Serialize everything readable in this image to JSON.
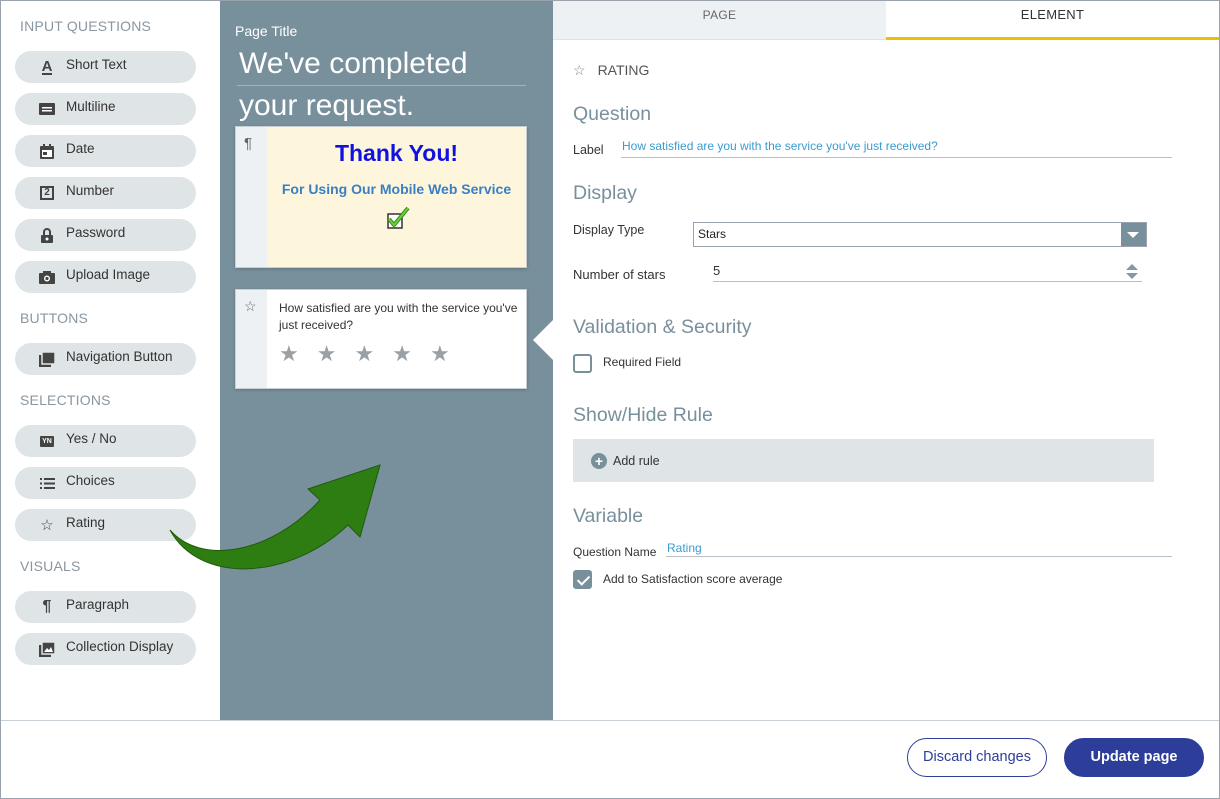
{
  "palette": {
    "sections": {
      "input_questions": "INPUT QUESTIONS",
      "buttons": "BUTTONS",
      "selections": "SELECTIONS",
      "visuals": "VISUALS"
    },
    "items": {
      "short_text": "Short Text",
      "multiline": "Multiline",
      "date": "Date",
      "number": "Number",
      "password": "Password",
      "upload_image": "Upload Image",
      "navigation_button": "Navigation Button",
      "yes_no": "Yes / No",
      "choices": "Choices",
      "rating": "Rating",
      "paragraph": "Paragraph",
      "collection_display": "Collection Display"
    },
    "icons": {
      "short_text": "A",
      "number": "2",
      "yes_no": "YN",
      "rating": "☆",
      "paragraph": "¶"
    }
  },
  "canvas": {
    "page_title_label": "Page Title",
    "page_title_line1": "We've completed",
    "page_title_line2": "your request.",
    "paragraph_card": {
      "icon": "¶",
      "heading": "Thank You!",
      "subheading": "For Using Our Mobile Web Service"
    },
    "rating_card": {
      "icon": "☆",
      "question": "How satisfied are you with the service you've just received?",
      "star_count": 5
    }
  },
  "props": {
    "tabs": {
      "page": "PAGE",
      "element": "ELEMENT"
    },
    "element_type": "RATING",
    "element_icon": "☆",
    "question": {
      "heading": "Question",
      "label_label": "Label",
      "label_value": "How satisfied are you with the service you've just received?"
    },
    "display": {
      "heading": "Display",
      "type_label": "Display Type",
      "type_value": "Stars",
      "stars_label": "Number of stars",
      "stars_value": "5"
    },
    "validation": {
      "heading": "Validation & Security",
      "required_label": "Required Field",
      "required_checked": false
    },
    "rules": {
      "heading": "Show/Hide Rule",
      "add_rule": "Add rule",
      "add_icon": "+"
    },
    "variable": {
      "heading": "Variable",
      "name_label": "Question Name",
      "name_value": "Rating",
      "satisfaction_label": "Add to Satisfaction score average",
      "satisfaction_checked": true
    }
  },
  "footer": {
    "discard": "Discard changes",
    "update": "Update page"
  },
  "colors": {
    "canvas_bg": "#788f9c",
    "primary": "#2c3e9a",
    "accent_underline": "#f0c000",
    "arrow": "#2e7d12"
  }
}
